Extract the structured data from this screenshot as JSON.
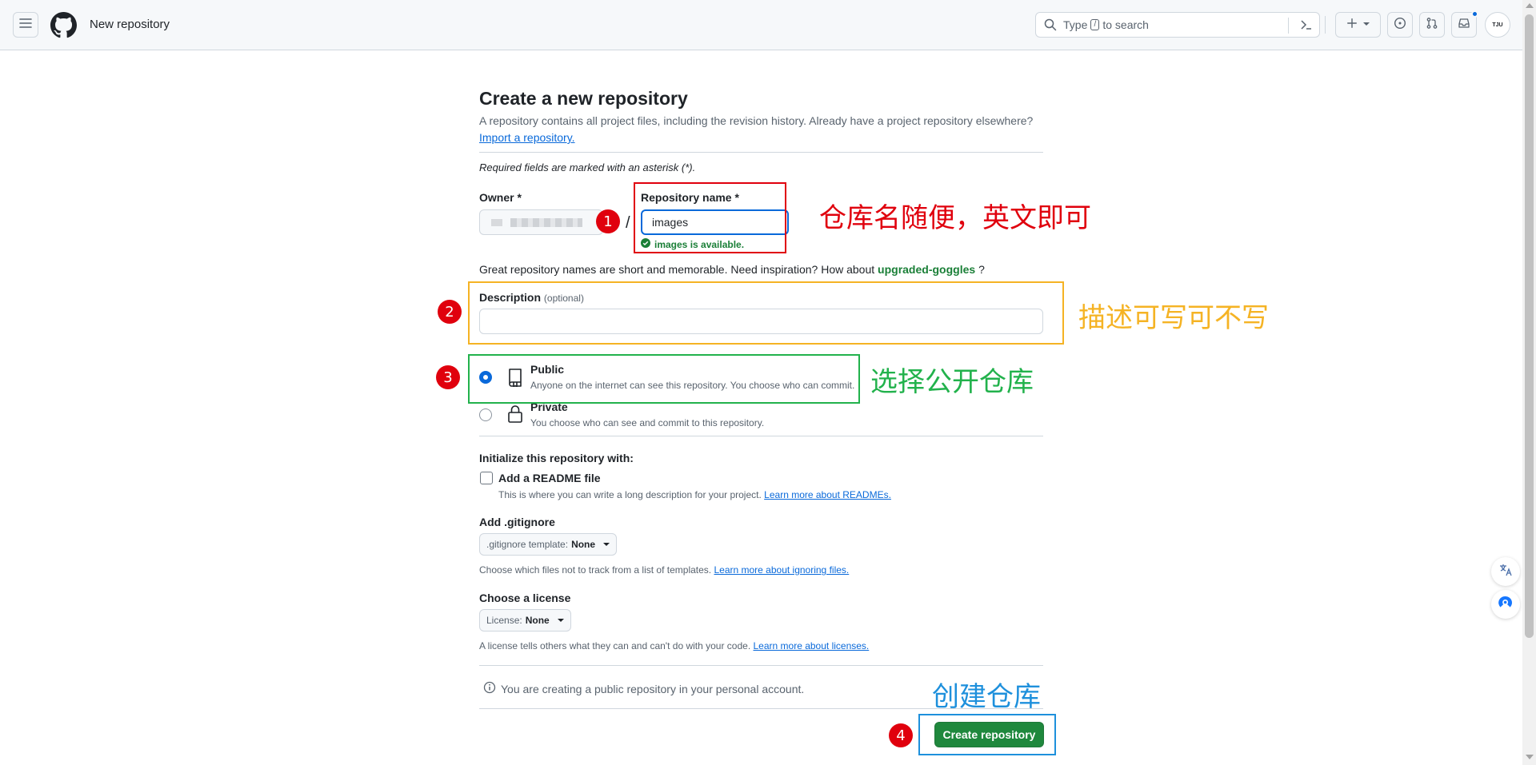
{
  "header": {
    "title": "New repository",
    "search": {
      "prefix": "Type",
      "key": "/",
      "suffix": "to search"
    },
    "icons": [
      "hamburger-icon",
      "github-logo-icon",
      "search-icon",
      "command-palette-icon",
      "plus-icon",
      "chevron-down-icon",
      "issue-icon",
      "pull-request-icon",
      "inbox-icon"
    ],
    "avatar_text": "TJU"
  },
  "form": {
    "title": "Create a new repository",
    "intro": "A repository contains all project files, including the revision history. Already have a project repository elsewhere?",
    "import_link": "Import a repository.",
    "required_note": "Required fields are marked with an asterisk (*).",
    "owner_label": "Owner *",
    "slash": "/",
    "repo_name_label": "Repository name *",
    "repo_name_value": "images",
    "availability": "images is available.",
    "suggestion_prefix": "Great repository names are short and memorable. Need inspiration? How about",
    "suggestion_name": "upgraded-goggles",
    "suggestion_suffix": "?",
    "description_label": "Description",
    "description_optional": "(optional)",
    "description_value": "",
    "visibility": {
      "selected": "Public",
      "public_title": "Public",
      "public_desc": "Anyone on the internet can see this repository. You choose who can commit.",
      "private_title": "Private",
      "private_desc": "You choose who can see and commit to this repository."
    },
    "init_label": "Initialize this repository with:",
    "readme_label": "Add a README file",
    "readme_checked": false,
    "readme_desc": "This is where you can write a long description for your project.",
    "readme_link": "Learn more about READMEs.",
    "gitignore_label": "Add .gitignore",
    "gitignore_prefix": ".gitignore template:",
    "gitignore_value": "None",
    "gitignore_desc": "Choose which files not to track from a list of templates.",
    "gitignore_link": "Learn more about ignoring files.",
    "license_label": "Choose a license",
    "license_prefix": "License:",
    "license_value": "None",
    "license_desc": "A license tells others what they can and can't do with your code.",
    "license_link": "Learn more about licenses.",
    "info_text": "You are creating a public repository in your personal account.",
    "create_button": "Create repository"
  },
  "annotations": [
    {
      "number": "1",
      "text": "仓库名随便，英文即可",
      "color": "#e0000d"
    },
    {
      "number": "2",
      "text": "描述可写可不写",
      "color": "#f5b324"
    },
    {
      "number": "3",
      "text": "选择公开仓库",
      "color": "#22b24c"
    },
    {
      "number": "4",
      "text": "创建仓库",
      "color": "#1e90dc"
    }
  ],
  "colors": {
    "primary_button": "#1f883d",
    "link": "#0969da",
    "success": "#1a7f37",
    "annotation_marker": "#e0000d"
  }
}
